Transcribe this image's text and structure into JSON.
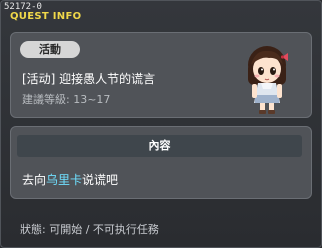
{
  "window": {
    "quest_id": "52172-0",
    "title": "QUEST INFO"
  },
  "quest": {
    "category_badge": "活動",
    "title": "[活动] 迎接愚人节的谎言",
    "recommended_level": "建議等級: 13~17",
    "npc_icon": "girl-npc-portrait"
  },
  "content": {
    "header": "內容",
    "text_before": "去向",
    "npc_name": "乌里卡",
    "text_after": "说谎吧"
  },
  "status": "狀態: 可開始 / 不可执行任務",
  "colors": {
    "title": "#f0d84a",
    "npc_highlight": "#6fe0ff"
  }
}
